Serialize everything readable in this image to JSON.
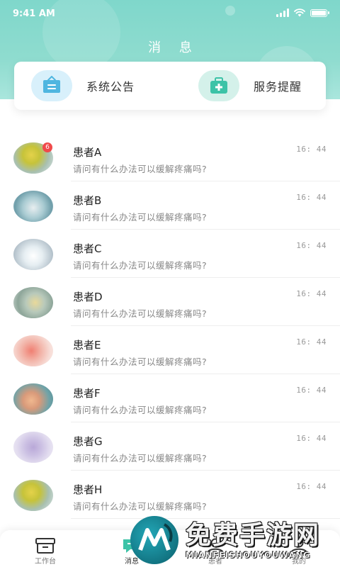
{
  "status_bar": {
    "time": "9:41 AM"
  },
  "header": {
    "title": "消 息"
  },
  "shortcuts": [
    {
      "label": "系统公告",
      "icon": "notice-board-icon",
      "color": "#4fb6e0"
    },
    {
      "label": "服务提醒",
      "icon": "medical-kit-icon",
      "color": "#3cc3a7"
    }
  ],
  "messages": [
    {
      "name": "患者A",
      "preview": "请问有什么办法可以缓解疼痛吗?",
      "time": "16: 44",
      "unread": "6"
    },
    {
      "name": "患者B",
      "preview": "请问有什么办法可以缓解疼痛吗?",
      "time": "16: 44"
    },
    {
      "name": "患者C",
      "preview": "请问有什么办法可以缓解疼痛吗?",
      "time": "16: 44"
    },
    {
      "name": "患者D",
      "preview": "请问有什么办法可以缓解疼痛吗?",
      "time": "16: 44"
    },
    {
      "name": "患者E",
      "preview": "请问有什么办法可以缓解疼痛吗?",
      "time": "16: 44"
    },
    {
      "name": "患者F",
      "preview": "请问有什么办法可以缓解疼痛吗?",
      "time": "16: 44"
    },
    {
      "name": "患者G",
      "preview": "请问有什么办法可以缓解疼痛吗?",
      "time": "16: 44"
    },
    {
      "name": "患者H",
      "preview": "请问有什么办法可以缓解疼痛吗?",
      "time": "16: 44"
    }
  ],
  "tabbar": {
    "tabs": [
      {
        "label": "工作台",
        "icon": "workbench-icon"
      },
      {
        "label": "消息",
        "icon": "message-icon",
        "active": true
      },
      {
        "label": "患者",
        "icon": "patient-icon"
      },
      {
        "label": "我的",
        "icon": "profile-icon"
      }
    ]
  },
  "watermark": {
    "title": "免费手游网",
    "subtitle": "MIANFEISHOUYOUWANG"
  },
  "colors": {
    "header": "#8fdccf",
    "badge": "#f04a4a",
    "accent": "#3cc3a7"
  }
}
